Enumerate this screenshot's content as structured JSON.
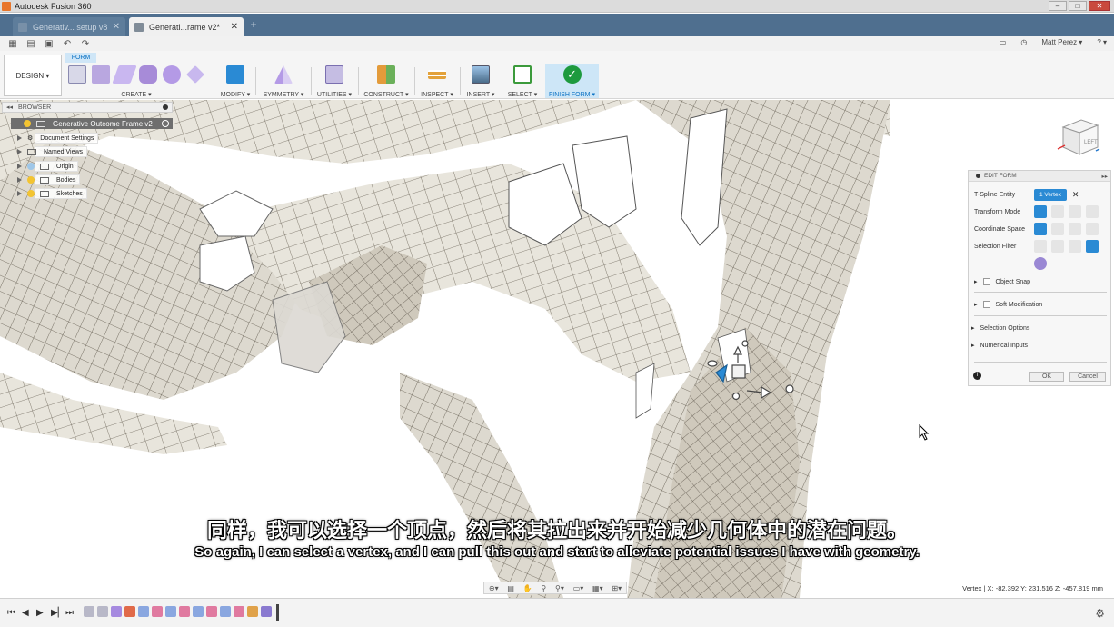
{
  "window": {
    "title": "Autodesk Fusion 360",
    "buttons": [
      "–",
      "□",
      "✕"
    ]
  },
  "tabs": {
    "inactive_label": "Generativ... setup v8",
    "active_label": "Generati...rame v2*",
    "close": "✕",
    "add": "+"
  },
  "qbar": {
    "user": "Matt Perez ▾",
    "help": "? ▾"
  },
  "toolbar": {
    "workspace": "DESIGN ▾",
    "active_tab": "FORM",
    "groups": {
      "create": "CREATE ▾",
      "modify": "MODIFY ▾",
      "symmetry": "SYMMETRY ▾",
      "utilities": "UTILITIES ▾",
      "construct": "CONSTRUCT ▾",
      "inspect": "INSPECT ▾",
      "insert": "INSERT ▾",
      "select": "SELECT ▾",
      "finish_form": "FINISH FORM ▾"
    }
  },
  "browser": {
    "header": "BROWSER",
    "root": "Generative Outcome Frame v2",
    "items": [
      "Document Settings",
      "Named Views",
      "Origin",
      "Bodies",
      "Sketches"
    ]
  },
  "viewcube": {
    "face": "LEFT"
  },
  "edit_form": {
    "header": "EDIT FORM",
    "tspline_label": "T-Spline Entity",
    "vertex_chip": "1 Vertex",
    "transform_mode": "Transform Mode",
    "coordinate_space": "Coordinate Space",
    "selection_filter": "Selection Filter",
    "object_snap": "Object Snap",
    "soft_modification": "Soft Modification",
    "selection_options": "Selection Options",
    "numerical_inputs": "Numerical Inputs",
    "ok": "OK",
    "cancel": "Cancel",
    "info": "i"
  },
  "subtitles": {
    "cn": "同样，我可以选择一个顶点，然后将其拉出来并开始减少几何体中的潜在问题。",
    "en": "So again, I can select a vertex, and I can pull this out and start to alleviate potential issues I have with geometry."
  },
  "status": {
    "coords": "Vertex | X: -82.392 Y: 231.516 Z: -457.819 mm"
  },
  "colors": {
    "accent": "#2a8ad4",
    "tabbar": "#4f6f8f",
    "finish": "#1d9a3e",
    "mesh_fill": "#e8e5dc",
    "mesh_line": "#6b6458"
  }
}
